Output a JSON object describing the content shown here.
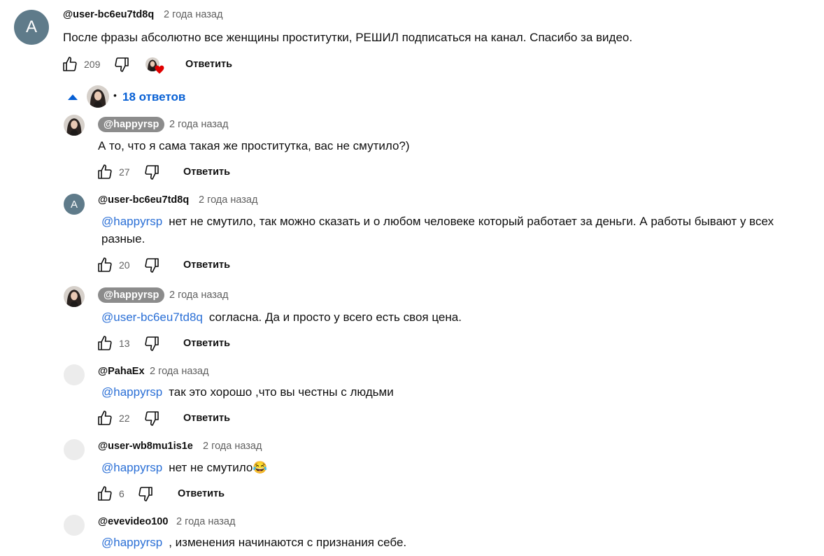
{
  "comment": {
    "avatar_letter": "A",
    "author": "@user-bc6eu7td8q",
    "time": "2 года назад",
    "text": "После фразы абсолютно все женщины проститутки, РЕШИЛ подписаться на канал. Спасибо за видео.",
    "likes": "209",
    "reply_label": "Ответить"
  },
  "replies_toggle": {
    "label": "18 ответов",
    "separator": "•"
  },
  "replies": [
    {
      "author": "@happyrsp",
      "time": "2 года назад",
      "mention": "",
      "text": "А то, что я сама такая же проститутка, вас не смутило?)",
      "likes": "27",
      "reply_label": "Ответить"
    },
    {
      "avatar_letter": "A",
      "author": "@user-bc6eu7td8q",
      "time": "2 года назад",
      "mention": "@happyrsp",
      "text": "нет не смутило, так можно сказать и о любом человеке который работает за деньги. А работы бывают у всех разные.",
      "likes": "20",
      "reply_label": "Ответить"
    },
    {
      "author": "@happyrsp",
      "time": "2 года назад",
      "mention": "@user-bc6eu7td8q",
      "text": "согласна. Да и просто у всего есть своя цена.",
      "likes": "13",
      "reply_label": "Ответить"
    },
    {
      "author": "@PahaEx",
      "time": "2 года назад",
      "mention": "@happyrsp",
      "text": "так это хорошо ,что вы честны с людьми",
      "likes": "22",
      "reply_label": "Ответить"
    },
    {
      "author": "@user-wb8mu1is1e",
      "time": "2 года назад",
      "mention": "@happyrsp",
      "text": "нет не смутило",
      "emoji": "😂",
      "likes": "6",
      "reply_label": "Ответить"
    },
    {
      "author": "@evevideo100",
      "time": "2 года назад",
      "mention": "@happyrsp",
      "text": ", изменения начинаются с признания себе."
    }
  ],
  "colors": {
    "link": "#065fd4",
    "mention": "#2a6fd6",
    "heart": "#e00000",
    "chip": "#8c8c8c"
  }
}
